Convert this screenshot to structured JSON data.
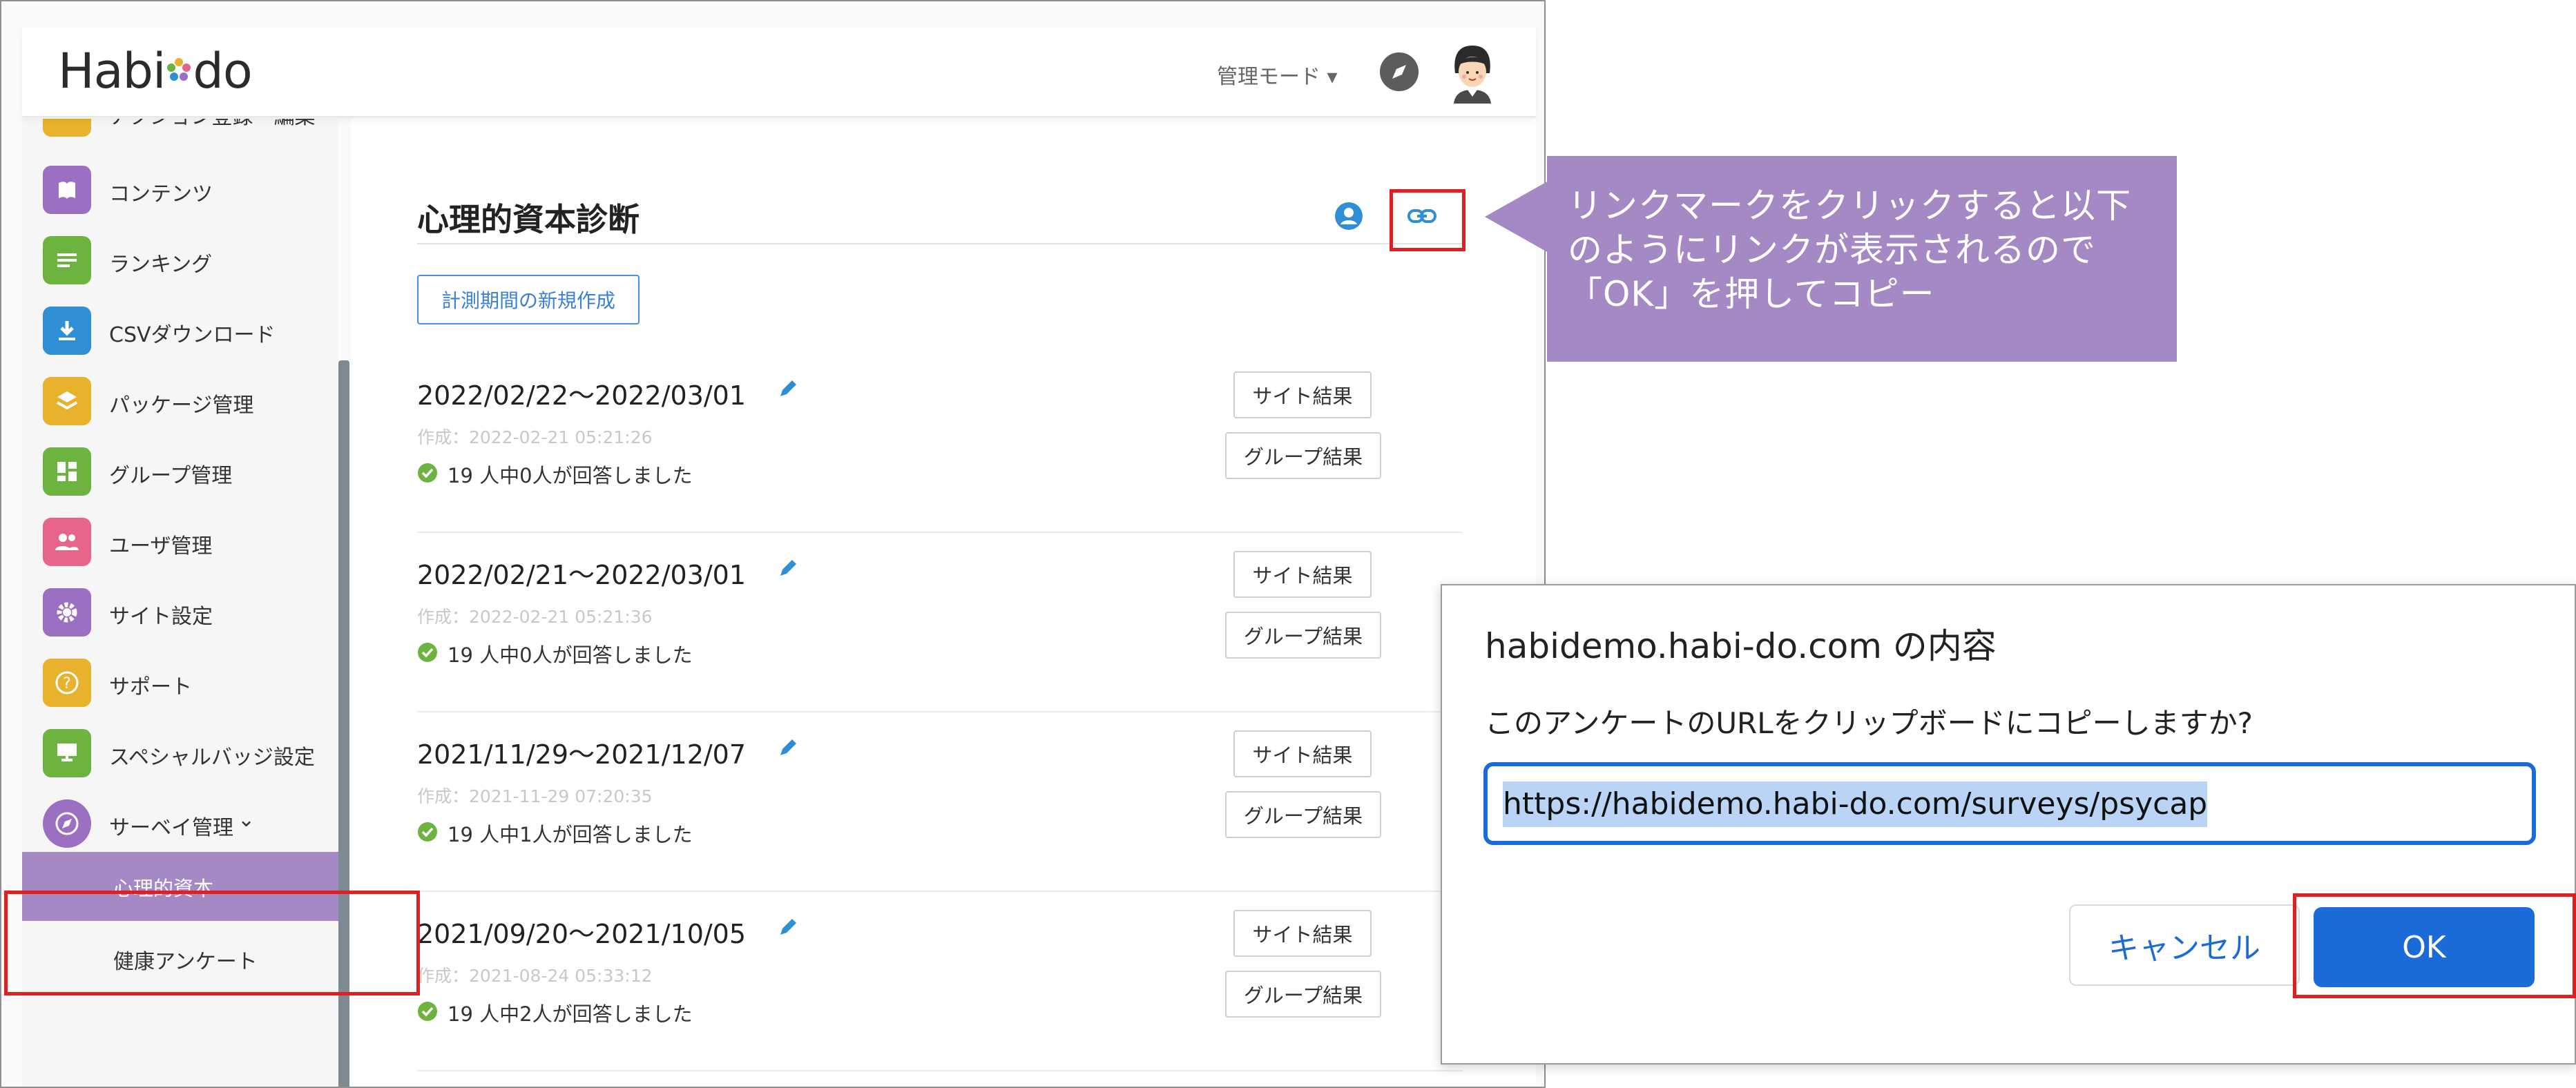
{
  "app": {
    "logo": {
      "pre": "Habi",
      "post": "do"
    },
    "mode_label": "管理モード",
    "compass_icon": "compass-icon",
    "avatar_icon": "avatar-icon"
  },
  "sidebar": {
    "partial_top_label": "アクション登録・編集",
    "items": [
      {
        "label": "コンテンツ",
        "icon": "book-icon",
        "color": "#9b6fc2"
      },
      {
        "label": "ランキング",
        "icon": "list-icon",
        "color": "#6cb33f"
      },
      {
        "label": "CSVダウンロード",
        "icon": "download-icon",
        "color": "#2e8fd6"
      },
      {
        "label": "パッケージ管理",
        "icon": "layers-icon",
        "color": "#e9b22c"
      },
      {
        "label": "グループ管理",
        "icon": "dashboard-icon",
        "color": "#6cb33f"
      },
      {
        "label": "ユーザ管理",
        "icon": "users-icon",
        "color": "#e8658a"
      },
      {
        "label": "サイト設定",
        "icon": "gear-icon",
        "color": "#9b6fc2"
      },
      {
        "label": "サポート",
        "icon": "help-icon",
        "color": "#e9b22c"
      },
      {
        "label": "スペシャルバッジ設定",
        "icon": "badge-icon",
        "color": "#6cb33f"
      },
      {
        "label": "サーベイ管理",
        "icon": "compass-icon",
        "color": "#9b6fc2"
      }
    ],
    "survey_sub": {
      "active": "心理的資本",
      "health": "健康アンケート"
    }
  },
  "main": {
    "title": "心理的資本診断",
    "new_period_button": "計測期間の新規作成",
    "site_result_label": "サイト結果",
    "group_result_label": "グループ結果",
    "entries": [
      {
        "period": "2022/02/22〜2022/03/01",
        "created": "作成：2022-02-21 05:21:26",
        "status": "19 人中0人が回答しました"
      },
      {
        "period": "2022/02/21〜2022/03/01",
        "created": "作成：2022-02-21 05:21:36",
        "status": "19 人中0人が回答しました"
      },
      {
        "period": "2021/11/29〜2021/12/07",
        "created": "作成：2021-11-29 07:20:35",
        "status": "19 人中1人が回答しました"
      },
      {
        "period": "2021/09/20〜2021/10/05",
        "created": "作成：2021-08-24 05:33:12",
        "status": "19 人中2人が回答しました"
      }
    ]
  },
  "callout": {
    "text": "リンクマークをクリックすると以下のようにリンクが表示されるので「OK」を押してコピー",
    "color": "#a589c4"
  },
  "dialog": {
    "title": "habidemo.habi-do.com の内容",
    "message": "このアンケートのURLをクリップボードにコピーしますか?",
    "url": "https://habidemo.habi-do.com/surveys/psycap",
    "cancel": "キャンセル",
    "ok": "OK",
    "accent": "#1a6bd7"
  },
  "highlight_color": "#e02020"
}
